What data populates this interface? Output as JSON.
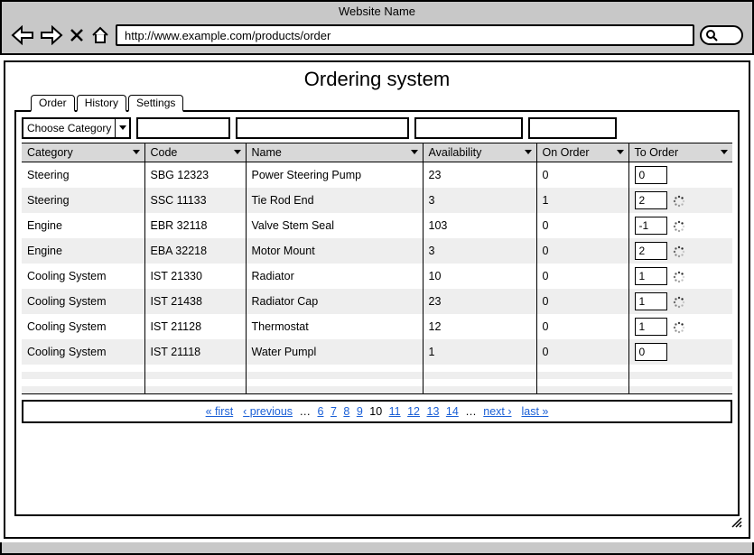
{
  "window": {
    "title": "Website Name",
    "url": "http://www.example.com/products/order"
  },
  "page": {
    "heading": "Ordering system"
  },
  "tabs": [
    {
      "label": "Order"
    },
    {
      "label": "History"
    },
    {
      "label": "Settings"
    }
  ],
  "category_select": {
    "label": "Choose Category"
  },
  "columns": {
    "category": "Category",
    "code": "Code",
    "name": "Name",
    "availability": "Availability",
    "on_order": "On Order",
    "to_order": "To Order"
  },
  "rows": [
    {
      "category": "Steering",
      "code": "SBG 12323",
      "name": "Power Steering Pump",
      "availability": "23",
      "on_order": "0",
      "to_order": "0",
      "spinner": false
    },
    {
      "category": "Steering",
      "code": "SSC 11133",
      "name": "Tie Rod End",
      "availability": "3",
      "on_order": "1",
      "to_order": "2",
      "spinner": true
    },
    {
      "category": "Engine",
      "code": "EBR 32118",
      "name": "Valve Stem Seal",
      "availability": "103",
      "on_order": "0",
      "to_order": "-1",
      "spinner": true
    },
    {
      "category": "Engine",
      "code": "EBA 32218",
      "name": "Motor Mount",
      "availability": "3",
      "on_order": "0",
      "to_order": "2",
      "spinner": true
    },
    {
      "category": "Cooling System",
      "code": "IST 21330",
      "name": "Radiator",
      "availability": "10",
      "on_order": "0",
      "to_order": "1",
      "spinner": true
    },
    {
      "category": "Cooling System",
      "code": "IST 21438",
      "name": "Radiator Cap",
      "availability": "23",
      "on_order": "0",
      "to_order": "1",
      "spinner": true
    },
    {
      "category": "Cooling System",
      "code": "IST 21128",
      "name": "Thermostat",
      "availability": "12",
      "on_order": "0",
      "to_order": "1",
      "spinner": true
    },
    {
      "category": "Cooling System",
      "code": "IST 21118",
      "name": "Water Pumpl",
      "availability": "1",
      "on_order": "0",
      "to_order": "0",
      "spinner": false
    }
  ],
  "pagination": {
    "first": "« first",
    "previous": "‹ previous",
    "pages": [
      "6",
      "7",
      "8",
      "9",
      "10",
      "11",
      "12",
      "13",
      "14"
    ],
    "current_page": "10",
    "next": "next ›",
    "last": "last »"
  }
}
